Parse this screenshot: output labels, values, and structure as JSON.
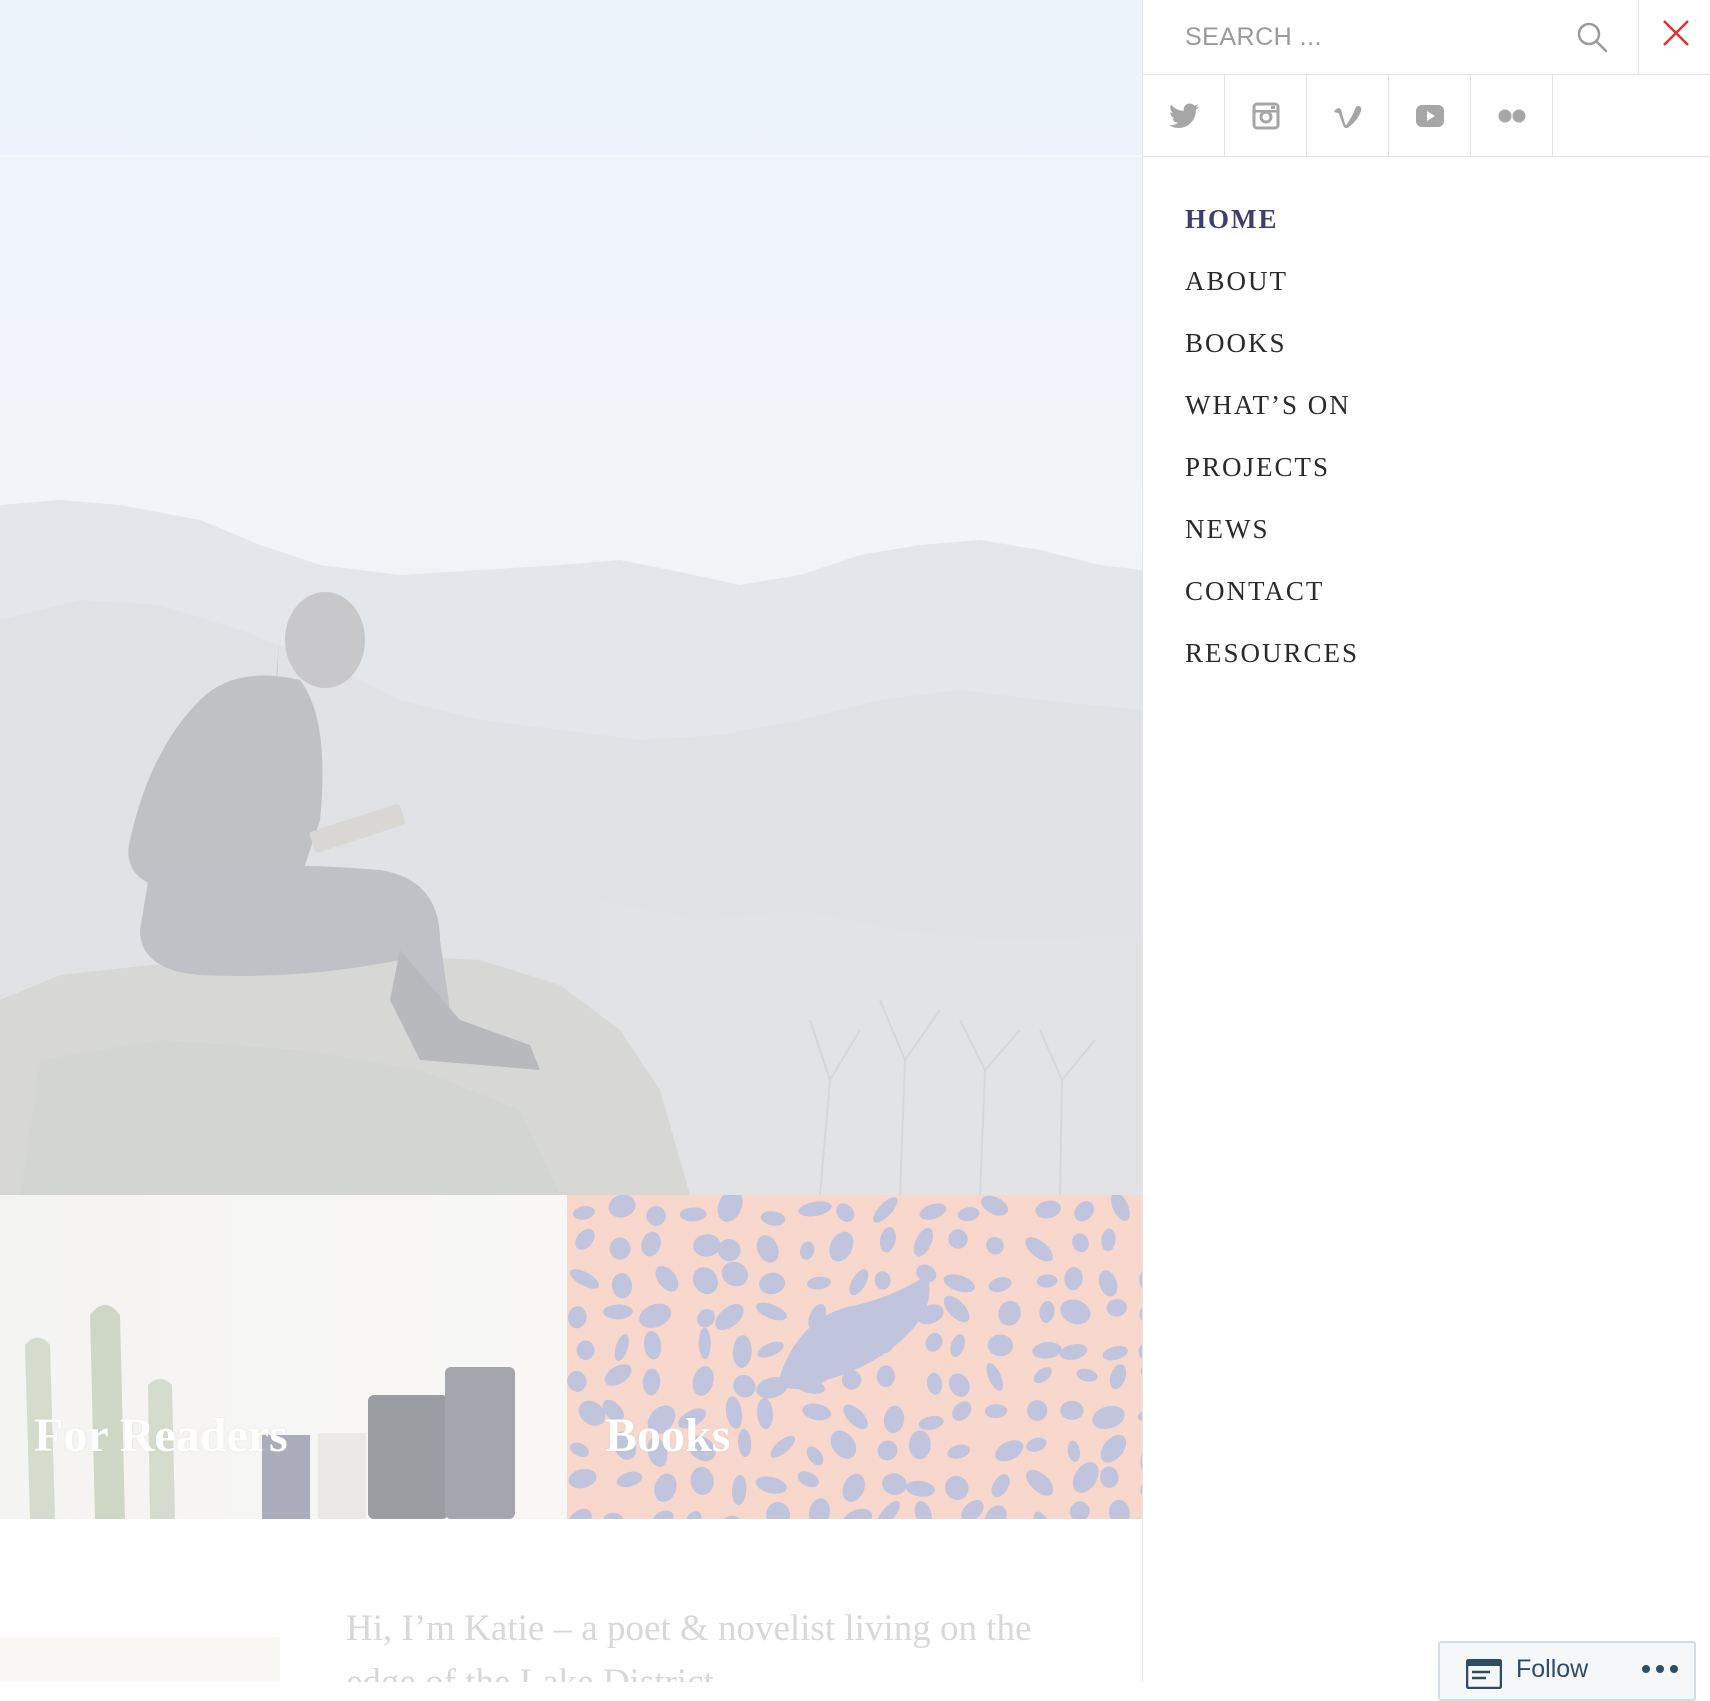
{
  "search": {
    "placeholder": "SEARCH ..."
  },
  "social": [
    {
      "icon": "twitter-icon"
    },
    {
      "icon": "instagram-icon"
    },
    {
      "icon": "vimeo-icon"
    },
    {
      "icon": "youtube-icon"
    },
    {
      "icon": "flickr-icon"
    }
  ],
  "nav": {
    "items": [
      {
        "label": "HOME",
        "active": true
      },
      {
        "label": "ABOUT"
      },
      {
        "label": "BOOKS"
      },
      {
        "label": "WHAT’S ON"
      },
      {
        "label": "PROJECTS"
      },
      {
        "label": "NEWS"
      },
      {
        "label": "CONTACT"
      },
      {
        "label": "RESOURCES"
      }
    ]
  },
  "tiles": {
    "readers": {
      "title": "For Readers"
    },
    "books": {
      "title": "Books"
    }
  },
  "intro": {
    "text": "Hi, I’m Katie – a poet & novelist living on the edge of the Lake District."
  },
  "follow": {
    "label": "Follow"
  },
  "colors": {
    "active_nav": "#3d3f73",
    "close": "#e0312b",
    "books_tile": "#f2b8a2",
    "books_pattern": "#8e94c2"
  }
}
